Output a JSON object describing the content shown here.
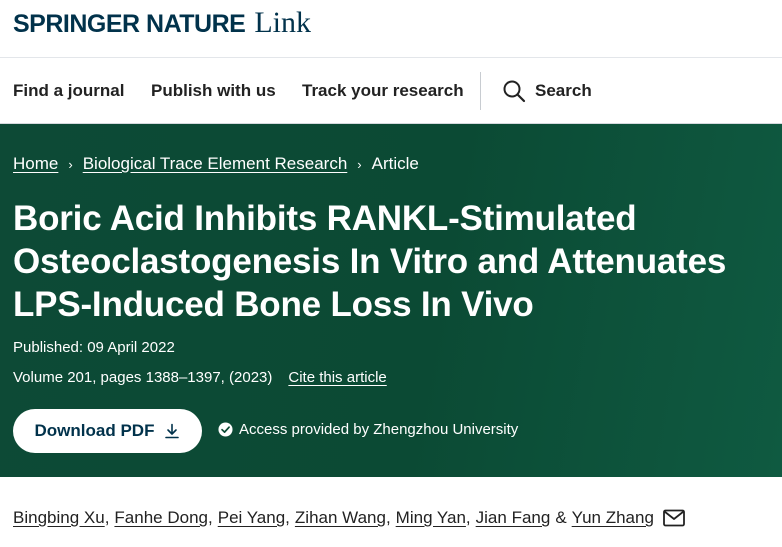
{
  "brand": {
    "name_strong": "SPRINGER NATURE",
    "name_link": "Link"
  },
  "nav": {
    "items": [
      "Find a journal",
      "Publish with us",
      "Track your research"
    ],
    "search_label": "Search"
  },
  "breadcrumb": {
    "home": "Home",
    "journal": "Biological Trace Element Research",
    "current": "Article",
    "separator": "›"
  },
  "article": {
    "title": "Boric Acid Inhibits RANKL-Stimulated Osteoclastogenesis In Vitro and Attenuates LPS-Induced Bone Loss In Vivo",
    "published": "Published: 09 April 2022",
    "volume": "Volume 201, pages 1388–1397, (2023)",
    "cite_label": "Cite this article"
  },
  "actions": {
    "download_label": "Download PDF",
    "access_text": "Access provided by Zhengzhou University"
  },
  "authors": {
    "names": [
      "Bingbing Xu",
      "Fanhe Dong",
      "Pei Yang",
      "Zihan Wang",
      "Ming Yan",
      "Jian Fang",
      "Yun Zhang"
    ],
    "comma": ",",
    "ampersand": "&"
  },
  "colors": {
    "brand_navy": "#01324b",
    "hero_green": "#0b4a34"
  },
  "icons": [
    "search-icon",
    "download-icon",
    "check-circle-icon",
    "mail-icon",
    "chevron-right-icon"
  ]
}
